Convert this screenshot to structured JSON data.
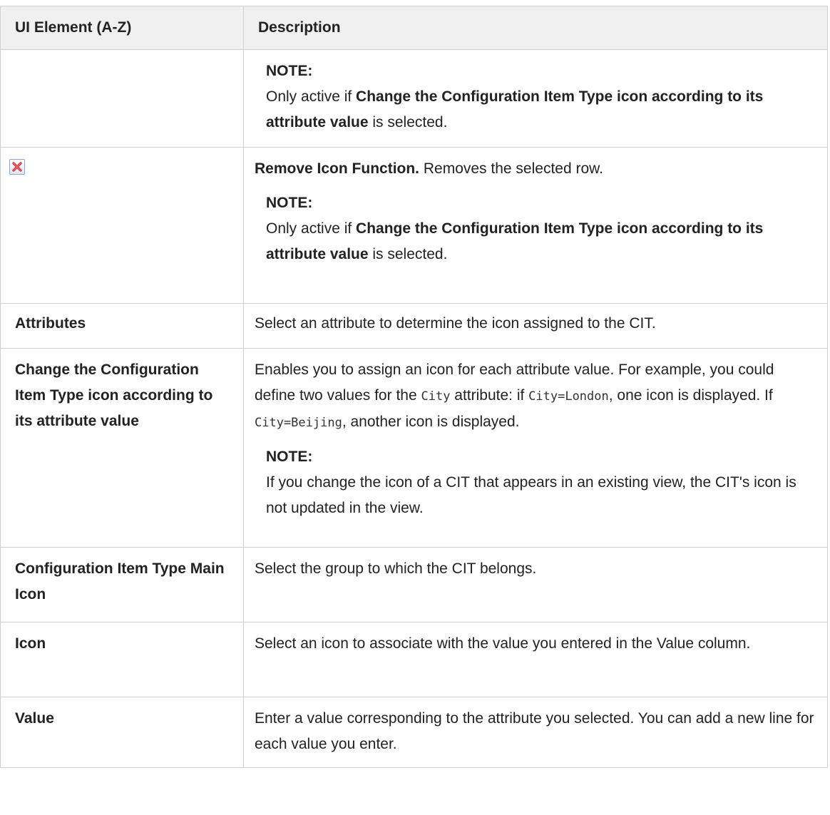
{
  "header": {
    "col1": "UI Element (A-Z)",
    "col2": "Description"
  },
  "rows": [
    {
      "element": "",
      "note_label": "NOTE:",
      "note_pre": "Only active if ",
      "note_bold": "Change the Configuration Item Type icon according to its attribute value",
      "note_post": " is selected."
    },
    {
      "icon": "remove-icon",
      "desc_bold": "Remove Icon Function.",
      "desc_text": " Removes the selected row.",
      "note_label": "NOTE:",
      "note_pre": "Only active if ",
      "note_bold": "Change the Configuration Item Type icon according to its attribute value",
      "note_post": " is selected."
    },
    {
      "element": "Attributes",
      "desc_text": "Select an attribute to determine the icon assigned to the CIT."
    },
    {
      "element": "Change the Configuration Item Type icon according to its attribute value",
      "desc_a": "Enables you to assign an icon for each attribute value. For example, you could define two values for the ",
      "code1": "City",
      "desc_b": " attribute: if ",
      "code2": "City=London",
      "desc_c": ", one icon is displayed. If ",
      "code3": "City=Beijing",
      "desc_d": ", another icon is displayed.",
      "note_label": "NOTE:",
      "note_text": "If you change the icon of a CIT that appears in an existing view, the CIT's icon is not updated in the view."
    },
    {
      "element": "Configuration Item Type Main Icon",
      "desc_text": "Select the group to which the CIT belongs."
    },
    {
      "element": "Icon",
      "desc_text": "Select an icon to associate with the value you entered in the Value column."
    },
    {
      "element": "Value",
      "desc_text": "Enter a value corresponding to the attribute you selected. You can add a new line for each value you enter."
    }
  ],
  "colors": {
    "header_bg": "#f0f0f0",
    "border": "#cfcfcf",
    "remove_icon_x": "#d9232a"
  }
}
